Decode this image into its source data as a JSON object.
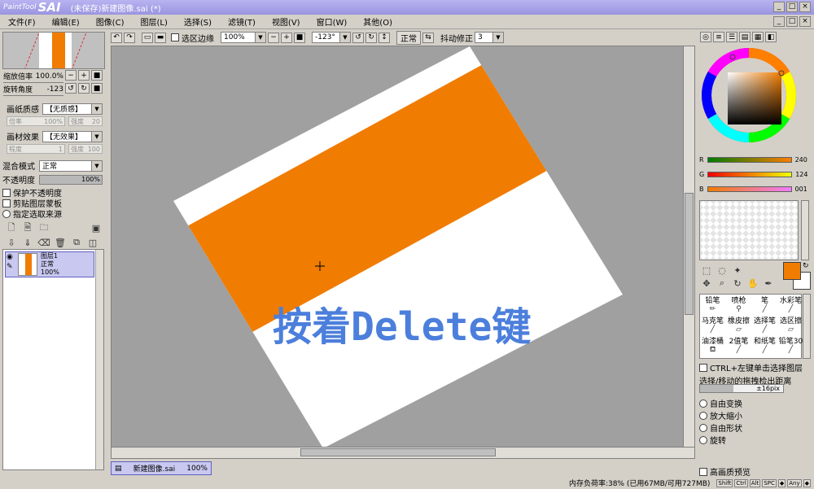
{
  "window": {
    "logo_small": "PaintTool",
    "logo_big": "SAI",
    "title": "(未保存)新建图像.sai (*)"
  },
  "menu": [
    "文件(F)",
    "编辑(E)",
    "图像(C)",
    "图层(L)",
    "选择(S)",
    "滤镜(T)",
    "视图(V)",
    "窗口(W)",
    "其他(O)"
  ],
  "navigator": {
    "zoom_label": "缩放倍率",
    "zoom_value": "100.0%",
    "angle_label": "旋转角度",
    "angle_value": "-123"
  },
  "paper": {
    "texture_label": "画纸质感",
    "texture_value": "【无质感】",
    "scale_label": "倍率",
    "scale_value": "100%",
    "strength_label": "强度",
    "strength_value": "20",
    "effect_label": "画材效果",
    "effect_value": "【无效果】",
    "degree_label": "程度",
    "degree_value": "1",
    "effect_strength_label": "强度",
    "effect_strength_value": "100"
  },
  "layer_props": {
    "blend_label": "混合模式",
    "blend_value": "正常",
    "opacity_label": "不透明度",
    "opacity_value": "100%",
    "protect_opacity": "保护不透明度",
    "clip_group": "剪贴图层蒙板",
    "selection_source": "指定选取来源"
  },
  "layer": {
    "name": "图层1",
    "mode": "正常",
    "opacity": "100%"
  },
  "toolbar": {
    "selection_edge": "选区边缘",
    "zoom": "100%",
    "angle": "-123°",
    "mode": "正常",
    "stabilizer_label": "抖动修正",
    "stabilizer_value": "3"
  },
  "canvas": {
    "overlay_text": "按着Delete键"
  },
  "tab": {
    "name": "新建图像.sai",
    "zoom": "100%"
  },
  "status": {
    "memory": "内存负荷率:38% (已用67MB/可用727MB)",
    "keys": [
      "Shift",
      "Ctrl",
      "Alt",
      "SPC",
      "◆",
      "Any",
      "◆"
    ]
  },
  "color": {
    "r_label": "R",
    "r_value": "240",
    "g_label": "G",
    "g_value": "124",
    "b_label": "B",
    "b_value": "001",
    "primary": "#f07c01",
    "secondary": "#ffffff"
  },
  "tools": [
    "铅笔",
    "喷枪",
    "笔",
    "水彩笔",
    "马克笔",
    "橡皮擦",
    "选择笔",
    "选区擦",
    "油漆桶",
    "2值笔",
    "和纸笔",
    "铅笔30"
  ],
  "tool_options": {
    "ctrl_select": "CTRL+左键单击选择图层",
    "drag_distance_label": "选择/移动的拖拽检出距离",
    "drag_distance_value": "±16pix",
    "free_transform": "自由变换",
    "scale": "放大缩小",
    "deform": "自由形状",
    "rotate": "旋转",
    "hq_preview": "高画质预览"
  }
}
